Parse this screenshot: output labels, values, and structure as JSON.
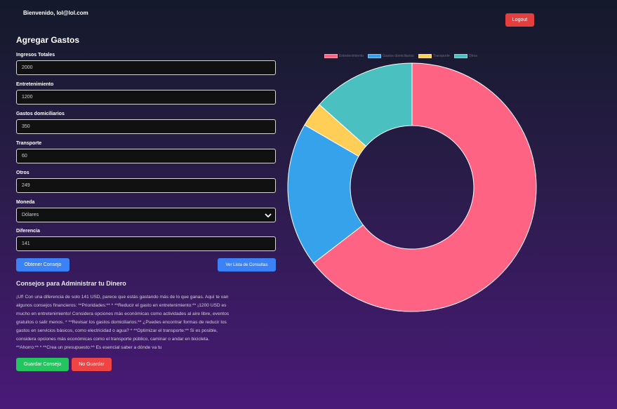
{
  "header": {
    "welcome": "Bienvenido, lol@lol.com",
    "logout_label": "Logout"
  },
  "form": {
    "title": "Agregar Gastos",
    "fields": [
      {
        "label": "Ingresos Totales",
        "value": "2000"
      },
      {
        "label": "Entretenimiento",
        "value": "1200"
      },
      {
        "label": "Gastos domiciliarios",
        "value": "350"
      },
      {
        "label": "Transporte",
        "value": "60"
      },
      {
        "label": "Otros",
        "value": "249"
      }
    ],
    "currency": {
      "label": "Moneda",
      "value": "Dólares"
    },
    "difference": {
      "label": "Diferencia",
      "value": "141"
    },
    "get_advice_label": "Obtener Consejo",
    "view_list_label": "Ver Lista de Consultas"
  },
  "advice": {
    "title": "Consejos para Administrar tu Dinero",
    "lines": [
      "¡Uf! Con una diferencia de solo 141 USD, parece que estás gastando más de lo que ganas. Aquí te van",
      "algunos consejos financieros: **Prioridades:** * **Reducir el gasto en entretenimiento:** ¡1200 USD es",
      "mucho en entretenimiento! Considera opciones más económicas como actividades al aire libre, eventos",
      "gratuitos o salir menos. * **Revisar los gastos domiciliarios:** ¿Puedes encontrar formas de reducir los",
      "gastos en servicios básicos, como electricidad o agua? * **Optimizar el transporte:** Si es posible,",
      "considera opciones más económicas como el transporte público, caminar o andar en bicicleta.",
      "**Ahorro:** * **Crea un presupuesto:** Es esencial saber a dónde va tu"
    ],
    "save_label": "Guardar Consejo",
    "discard_label": "No Guardar"
  },
  "chart_data": {
    "type": "doughnut",
    "categories": [
      "Entretenimiento",
      "Gastos domiciliarios",
      "Transporte",
      "Otros"
    ],
    "values": [
      1200,
      350,
      60,
      249
    ],
    "colors": [
      "#ff6384",
      "#36a2eb",
      "#ffce56",
      "#4bc0c0"
    ],
    "legend": "top"
  }
}
